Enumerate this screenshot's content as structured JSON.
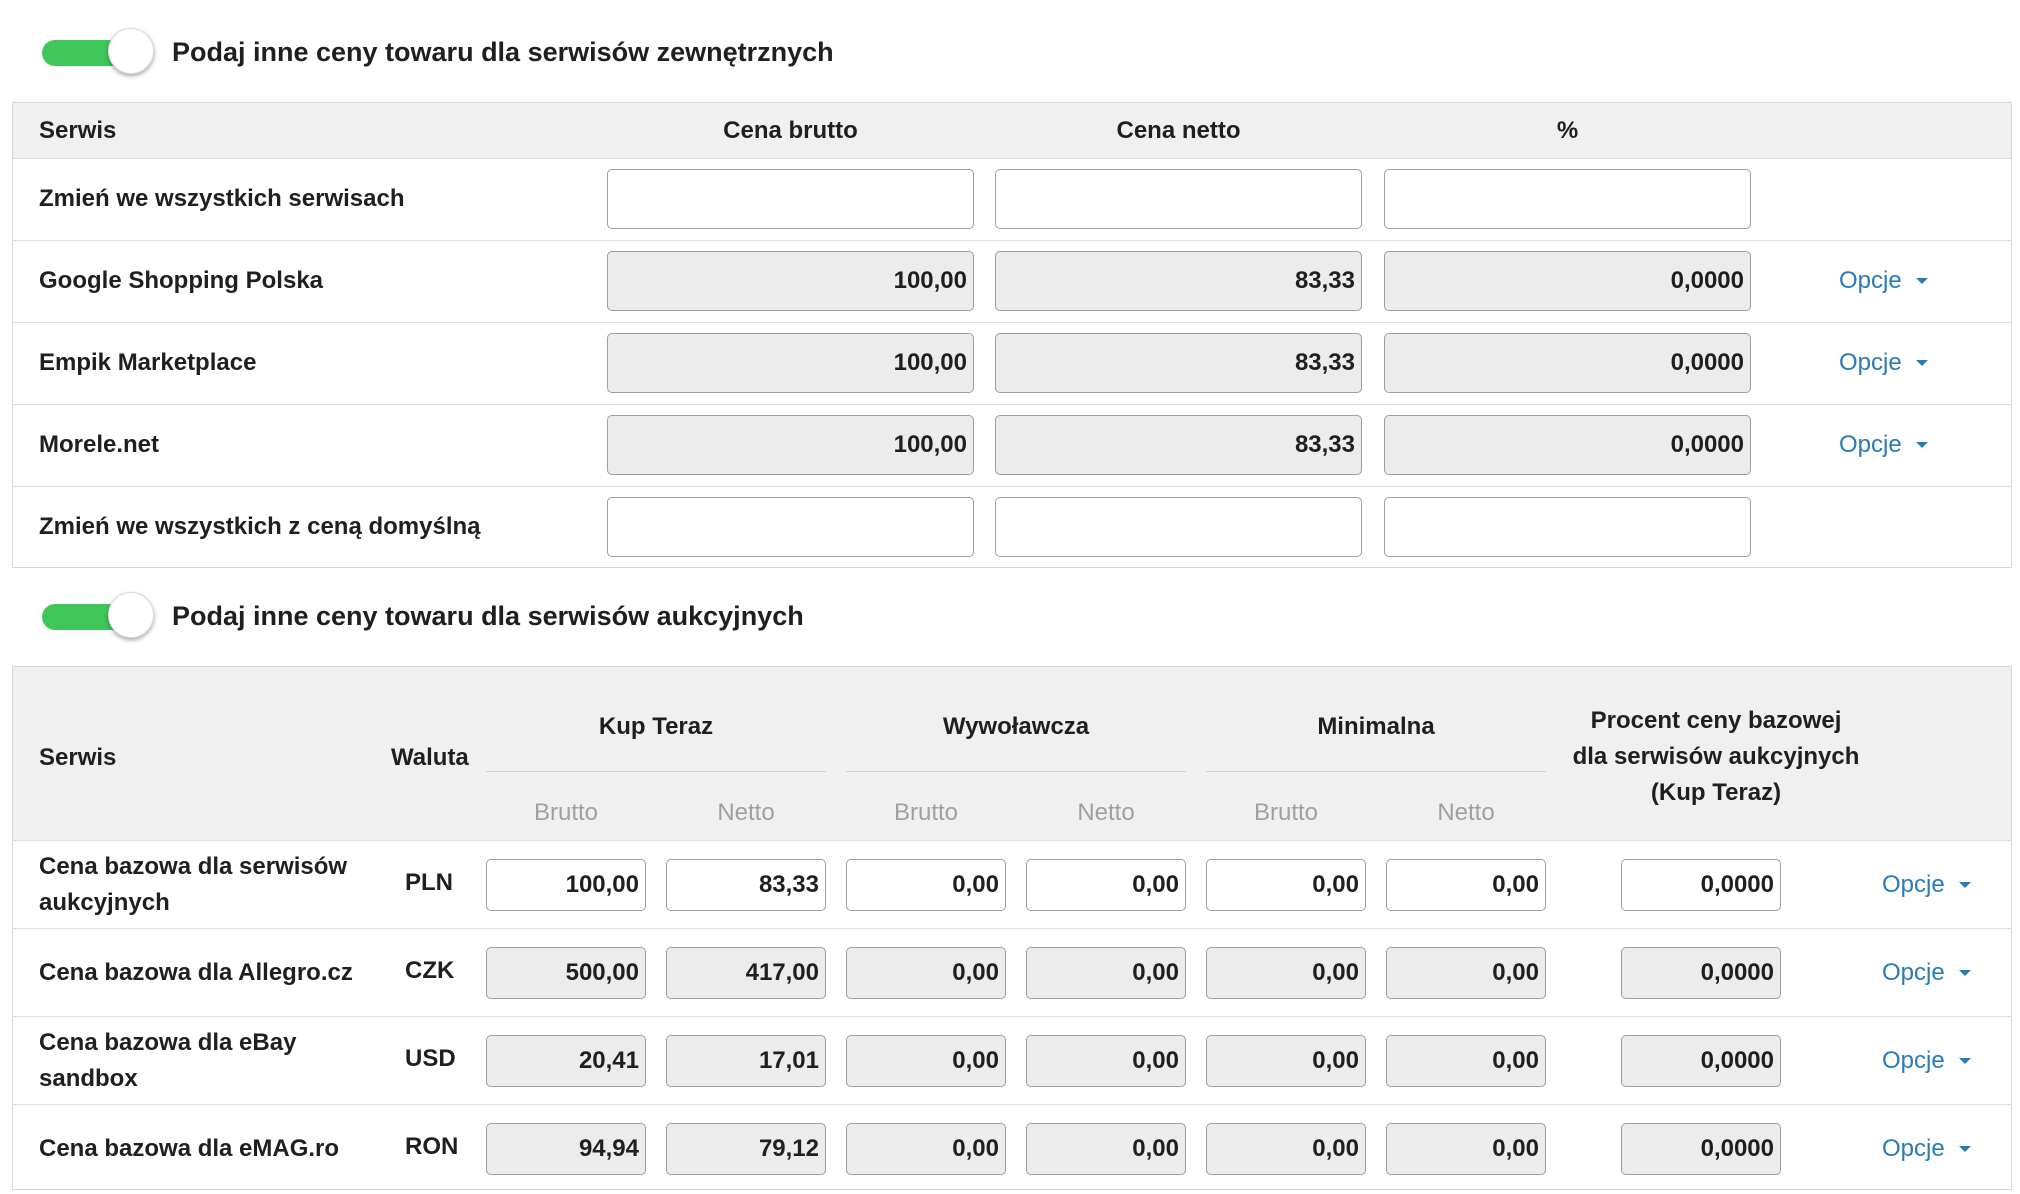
{
  "external": {
    "toggle_label": "Podaj inne ceny towaru dla serwisów zewnętrznych",
    "toggle_on": true,
    "headers": {
      "service": "Serwis",
      "gross": "Cena brutto",
      "net": "Cena netto",
      "percent": "%"
    },
    "rows": [
      {
        "name": "Zmień we wszystkich serwisach",
        "gross": "",
        "net": "",
        "percent": "",
        "readonly": false,
        "options": ""
      },
      {
        "name": "Google Shopping Polska",
        "gross": "100,00",
        "net": "83,33",
        "percent": "0,0000",
        "readonly": true,
        "options": "Opcje"
      },
      {
        "name": "Empik Marketplace",
        "gross": "100,00",
        "net": "83,33",
        "percent": "0,0000",
        "readonly": true,
        "options": "Opcje"
      },
      {
        "name": "Morele.net",
        "gross": "100,00",
        "net": "83,33",
        "percent": "0,0000",
        "readonly": true,
        "options": "Opcje"
      },
      {
        "name": "Zmień we wszystkich z ceną domyślną",
        "gross": "",
        "net": "",
        "percent": "",
        "readonly": false,
        "options": ""
      }
    ]
  },
  "auction": {
    "toggle_label": "Podaj inne ceny towaru dla serwisów aukcyjnych",
    "toggle_on": true,
    "headers": {
      "service": "Serwis",
      "currency": "Waluta",
      "buy_now": "Kup Teraz",
      "starting": "Wywoławcza",
      "minimum": "Minimalna",
      "percent_line1": "Procent ceny bazowej",
      "percent_line2": "dla serwisów aukcyjnych",
      "percent_line3": "(Kup Teraz)",
      "gross": "Brutto",
      "net": "Netto"
    },
    "rows": [
      {
        "name_line1": "Cena bazowa dla serwisów",
        "name_line2": "aukcyjnych",
        "currency": "PLN",
        "buy_gross": "100,00",
        "buy_net": "83,33",
        "start_gross": "0,00",
        "start_net": "0,00",
        "min_gross": "0,00",
        "min_net": "0,00",
        "percent": "0,0000",
        "readonly": false,
        "options": "Opcje"
      },
      {
        "name_line1": "Cena bazowa dla Allegro.cz",
        "name_line2": "",
        "currency": "CZK",
        "buy_gross": "500,00",
        "buy_net": "417,00",
        "start_gross": "0,00",
        "start_net": "0,00",
        "min_gross": "0,00",
        "min_net": "0,00",
        "percent": "0,0000",
        "readonly": true,
        "options": "Opcje"
      },
      {
        "name_line1": "Cena bazowa dla eBay",
        "name_line2": "sandbox",
        "currency": "USD",
        "buy_gross": "20,41",
        "buy_net": "17,01",
        "start_gross": "0,00",
        "start_net": "0,00",
        "min_gross": "0,00",
        "min_net": "0,00",
        "percent": "0,0000",
        "readonly": true,
        "options": "Opcje"
      },
      {
        "name_line1": "Cena bazowa dla eMAG.ro",
        "name_line2": "",
        "currency": "RON",
        "buy_gross": "94,94",
        "buy_net": "79,12",
        "start_gross": "0,00",
        "start_net": "0,00",
        "min_gross": "0,00",
        "min_net": "0,00",
        "percent": "0,0000",
        "readonly": true,
        "options": "Opcje"
      }
    ]
  },
  "colors": {
    "toggle_on": "#3fc65a",
    "link": "#2a7ab8",
    "header_bg": "#f0f0f0",
    "readonly_bg": "#ececec"
  }
}
